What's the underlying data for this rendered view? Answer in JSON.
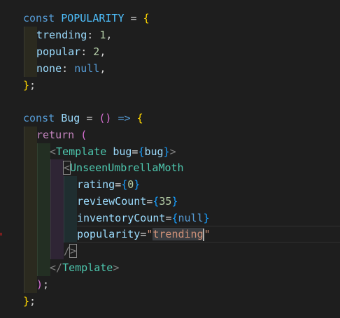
{
  "editor": {
    "lines": [
      {
        "kw": "const",
        "name": "POPULARITY",
        "eq": "=",
        "brace": "{"
      },
      {
        "key": "trending",
        "colon": ":",
        "val": "1",
        "comma": ","
      },
      {
        "key": "popular",
        "colon": ":",
        "val": "2",
        "comma": ","
      },
      {
        "key": "none",
        "colon": ":",
        "val": "null",
        "comma": ","
      },
      {
        "close": "}",
        "semi": ";"
      },
      {},
      {
        "kw": "const",
        "name": "Bug",
        "eq": "=",
        "paren": "()",
        "arrow": "=>",
        "brace": "{"
      },
      {
        "kw": "return",
        "paren": "("
      },
      {
        "lt": "<",
        "comp": "Template",
        "attr": "bug",
        "eq": "=",
        "ob": "{",
        "val": "bug",
        "cb": "}",
        "gt": ">"
      },
      {
        "lt": "<",
        "comp": "UnseenUmbrellaMoth"
      },
      {
        "attr": "rating",
        "eq": "=",
        "ob": "{",
        "val": "0",
        "cb": "}"
      },
      {
        "attr": "reviewCount",
        "eq": "=",
        "ob": "{",
        "val": "35",
        "cb": "}"
      },
      {
        "attr": "inventoryCount",
        "eq": "=",
        "ob": "{",
        "val": "null",
        "cb": "}"
      },
      {
        "attr": "popularity",
        "eq": "=",
        "q1": "\"",
        "val": "trending",
        "q2": "\""
      },
      {
        "slash": "/",
        "gt": ">"
      },
      {
        "lt": "</",
        "comp": "Template",
        "gt": ">"
      },
      {
        "paren": ")",
        "semi": ";"
      },
      {
        "close": "}",
        "semi": ";"
      }
    ]
  }
}
